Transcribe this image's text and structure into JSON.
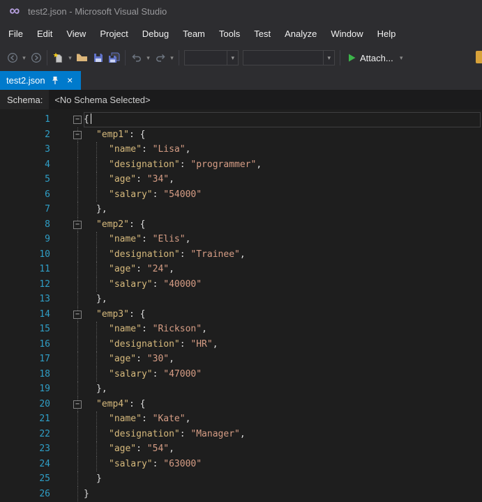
{
  "window": {
    "title": "test2.json - Microsoft Visual Studio"
  },
  "menu": {
    "items": [
      "File",
      "Edit",
      "View",
      "Project",
      "Debug",
      "Team",
      "Tools",
      "Test",
      "Analyze",
      "Window",
      "Help"
    ]
  },
  "toolbar": {
    "attach_label": "Attach...",
    "combo1_value": "",
    "combo2_value": ""
  },
  "tab": {
    "label": "test2.json"
  },
  "schema_bar": {
    "label": "Schema:",
    "value": "<No Schema Selected>"
  },
  "icons": {
    "dropdown_caret": "▾",
    "close": "×",
    "logo_infinity": "∞",
    "fold_collapse": "−"
  },
  "colors": {
    "accent_blue": "#007acc",
    "chrome_bg": "#2d2d30",
    "editor_bg": "#1e1e1e",
    "line_number": "#2f9fc7",
    "json_key": "#d7ba7d",
    "json_string": "#d69d85",
    "punctuation": "#dcdcdc",
    "attach_green": "#3cb44a"
  },
  "editor": {
    "lines": [
      {
        "n": 1,
        "indent": 0,
        "fold": true,
        "current": true,
        "caret": true,
        "tokens": [
          [
            "{",
            "p"
          ]
        ]
      },
      {
        "n": 2,
        "indent": 1,
        "fold": true,
        "fg": true,
        "tokens": [
          [
            "\"emp1\"",
            "k"
          ],
          [
            ": ",
            "p"
          ],
          [
            "{",
            "p"
          ]
        ]
      },
      {
        "n": 3,
        "indent": 2,
        "fg": true,
        "guides": [
          1
        ],
        "tokens": [
          [
            "\"name\"",
            "k"
          ],
          [
            ": ",
            "p"
          ],
          [
            "\"Lisa\"",
            "v"
          ],
          [
            ",",
            "p"
          ]
        ]
      },
      {
        "n": 4,
        "indent": 2,
        "fg": true,
        "guides": [
          1
        ],
        "tokens": [
          [
            "\"designation\"",
            "k"
          ],
          [
            ": ",
            "p"
          ],
          [
            "\"programmer\"",
            "v"
          ],
          [
            ",",
            "p"
          ]
        ]
      },
      {
        "n": 5,
        "indent": 2,
        "fg": true,
        "guides": [
          1
        ],
        "tokens": [
          [
            "\"age\"",
            "k"
          ],
          [
            ": ",
            "p"
          ],
          [
            "\"34\"",
            "v"
          ],
          [
            ",",
            "p"
          ]
        ]
      },
      {
        "n": 6,
        "indent": 2,
        "fg": true,
        "guides": [
          1
        ],
        "tokens": [
          [
            "\"salary\"",
            "k"
          ],
          [
            ": ",
            "p"
          ],
          [
            "\"54000\"",
            "v"
          ]
        ]
      },
      {
        "n": 7,
        "indent": 1,
        "fg": true,
        "tokens": [
          [
            "},",
            "p"
          ]
        ]
      },
      {
        "n": 8,
        "indent": 1,
        "fold": true,
        "fg": true,
        "tokens": [
          [
            "\"emp2\"",
            "k"
          ],
          [
            ": ",
            "p"
          ],
          [
            "{",
            "p"
          ]
        ]
      },
      {
        "n": 9,
        "indent": 2,
        "fg": true,
        "guides": [
          1
        ],
        "tokens": [
          [
            "\"name\"",
            "k"
          ],
          [
            ": ",
            "p"
          ],
          [
            "\"Elis\"",
            "v"
          ],
          [
            ",",
            "p"
          ]
        ]
      },
      {
        "n": 10,
        "indent": 2,
        "fg": true,
        "guides": [
          1
        ],
        "tokens": [
          [
            "\"designation\"",
            "k"
          ],
          [
            ": ",
            "p"
          ],
          [
            "\"Trainee\"",
            "v"
          ],
          [
            ",",
            "p"
          ]
        ]
      },
      {
        "n": 11,
        "indent": 2,
        "fg": true,
        "guides": [
          1
        ],
        "tokens": [
          [
            "\"age\"",
            "k"
          ],
          [
            ": ",
            "p"
          ],
          [
            "\"24\"",
            "v"
          ],
          [
            ",",
            "p"
          ]
        ]
      },
      {
        "n": 12,
        "indent": 2,
        "fg": true,
        "guides": [
          1
        ],
        "tokens": [
          [
            "\"salary\"",
            "k"
          ],
          [
            ": ",
            "p"
          ],
          [
            "\"40000\"",
            "v"
          ]
        ]
      },
      {
        "n": 13,
        "indent": 1,
        "fg": true,
        "tokens": [
          [
            "},",
            "p"
          ]
        ]
      },
      {
        "n": 14,
        "indent": 1,
        "fold": true,
        "fg": true,
        "tokens": [
          [
            "\"emp3\"",
            "k"
          ],
          [
            ": ",
            "p"
          ],
          [
            "{",
            "p"
          ]
        ]
      },
      {
        "n": 15,
        "indent": 2,
        "fg": true,
        "guides": [
          1
        ],
        "tokens": [
          [
            "\"name\"",
            "k"
          ],
          [
            ": ",
            "p"
          ],
          [
            "\"Rickson\"",
            "v"
          ],
          [
            ",",
            "p"
          ]
        ]
      },
      {
        "n": 16,
        "indent": 2,
        "fg": true,
        "guides": [
          1
        ],
        "tokens": [
          [
            "\"designation\"",
            "k"
          ],
          [
            ": ",
            "p"
          ],
          [
            "\"HR\"",
            "v"
          ],
          [
            ",",
            "p"
          ]
        ]
      },
      {
        "n": 17,
        "indent": 2,
        "fg": true,
        "guides": [
          1
        ],
        "tokens": [
          [
            "\"age\"",
            "k"
          ],
          [
            ": ",
            "p"
          ],
          [
            "\"30\"",
            "v"
          ],
          [
            ",",
            "p"
          ]
        ]
      },
      {
        "n": 18,
        "indent": 2,
        "fg": true,
        "guides": [
          1
        ],
        "tokens": [
          [
            "\"salary\"",
            "k"
          ],
          [
            ": ",
            "p"
          ],
          [
            "\"47000\"",
            "v"
          ]
        ]
      },
      {
        "n": 19,
        "indent": 1,
        "fg": true,
        "tokens": [
          [
            "},",
            "p"
          ]
        ]
      },
      {
        "n": 20,
        "indent": 1,
        "fold": true,
        "fg": true,
        "tokens": [
          [
            "\"emp4\"",
            "k"
          ],
          [
            ": ",
            "p"
          ],
          [
            "{",
            "p"
          ]
        ]
      },
      {
        "n": 21,
        "indent": 2,
        "fg": true,
        "guides": [
          1
        ],
        "tokens": [
          [
            "\"name\"",
            "k"
          ],
          [
            ": ",
            "p"
          ],
          [
            "\"Kate\"",
            "v"
          ],
          [
            ",",
            "p"
          ]
        ]
      },
      {
        "n": 22,
        "indent": 2,
        "fg": true,
        "guides": [
          1
        ],
        "tokens": [
          [
            "\"designation\"",
            "k"
          ],
          [
            ": ",
            "p"
          ],
          [
            "\"Manager\"",
            "v"
          ],
          [
            ",",
            "p"
          ]
        ]
      },
      {
        "n": 23,
        "indent": 2,
        "fg": true,
        "guides": [
          1
        ],
        "tokens": [
          [
            "\"age\"",
            "k"
          ],
          [
            ": ",
            "p"
          ],
          [
            "\"54\"",
            "v"
          ],
          [
            ",",
            "p"
          ]
        ]
      },
      {
        "n": 24,
        "indent": 2,
        "fg": true,
        "guides": [
          1
        ],
        "tokens": [
          [
            "\"salary\"",
            "k"
          ],
          [
            ": ",
            "p"
          ],
          [
            "\"63000\"",
            "v"
          ]
        ]
      },
      {
        "n": 25,
        "indent": 1,
        "fg": true,
        "tokens": [
          [
            "}",
            "p"
          ]
        ]
      },
      {
        "n": 26,
        "indent": 0,
        "fg": true,
        "tokens": [
          [
            "}",
            "p"
          ]
        ]
      }
    ]
  }
}
